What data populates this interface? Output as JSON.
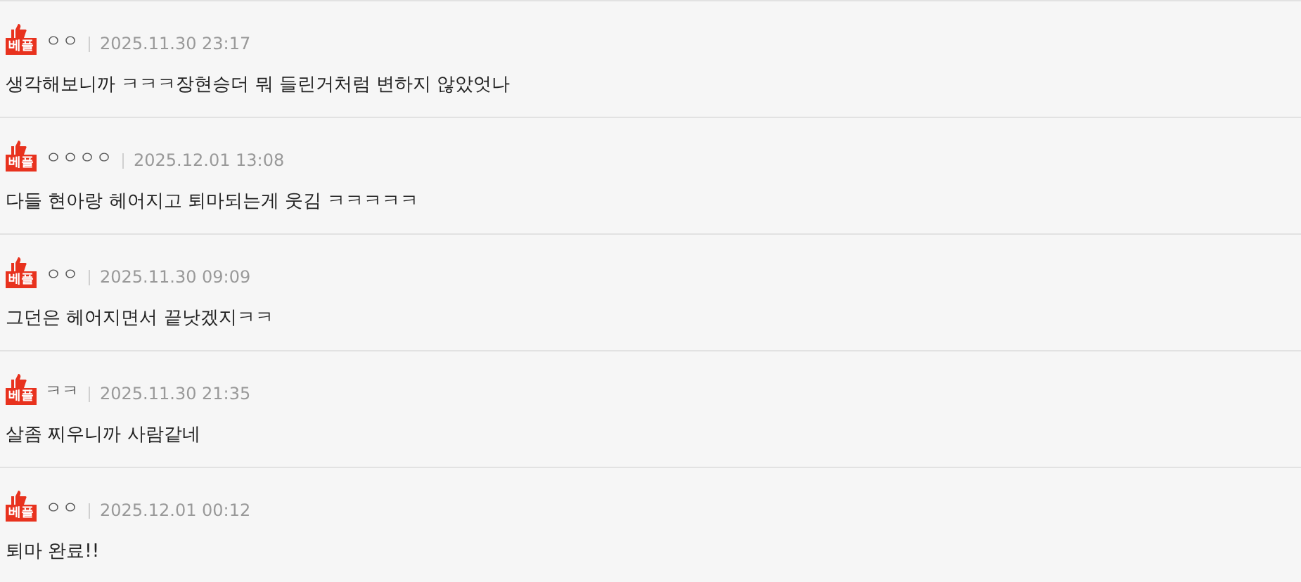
{
  "comments": [
    {
      "badge": "베플",
      "author": "ㅇㅇ",
      "date": "2025.11.30 23:17",
      "text": "생각해보니까 ㅋㅋㅋ장현승더 뭐 들린거처럼 변하지 않았엇나"
    },
    {
      "badge": "베플",
      "author": "ㅇㅇㅇㅇ",
      "date": "2025.12.01 13:08",
      "text": "다들 현아랑 헤어지고 퇴마되는게 웃김 ㅋㅋㅋㅋㅋ"
    },
    {
      "badge": "베플",
      "author": "ㅇㅇ",
      "date": "2025.11.30 09:09",
      "text": "그던은 헤어지면서 끝낫겠지ㅋㅋ"
    },
    {
      "badge": "베플",
      "author": "ㅋㅋ",
      "date": "2025.11.30 21:35",
      "text": "살좀 찌우니까 사람같네"
    },
    {
      "badge": "베플",
      "author": "ㅇㅇ",
      "date": "2025.12.01 00:12",
      "text": "퇴마 완료!!"
    }
  ]
}
